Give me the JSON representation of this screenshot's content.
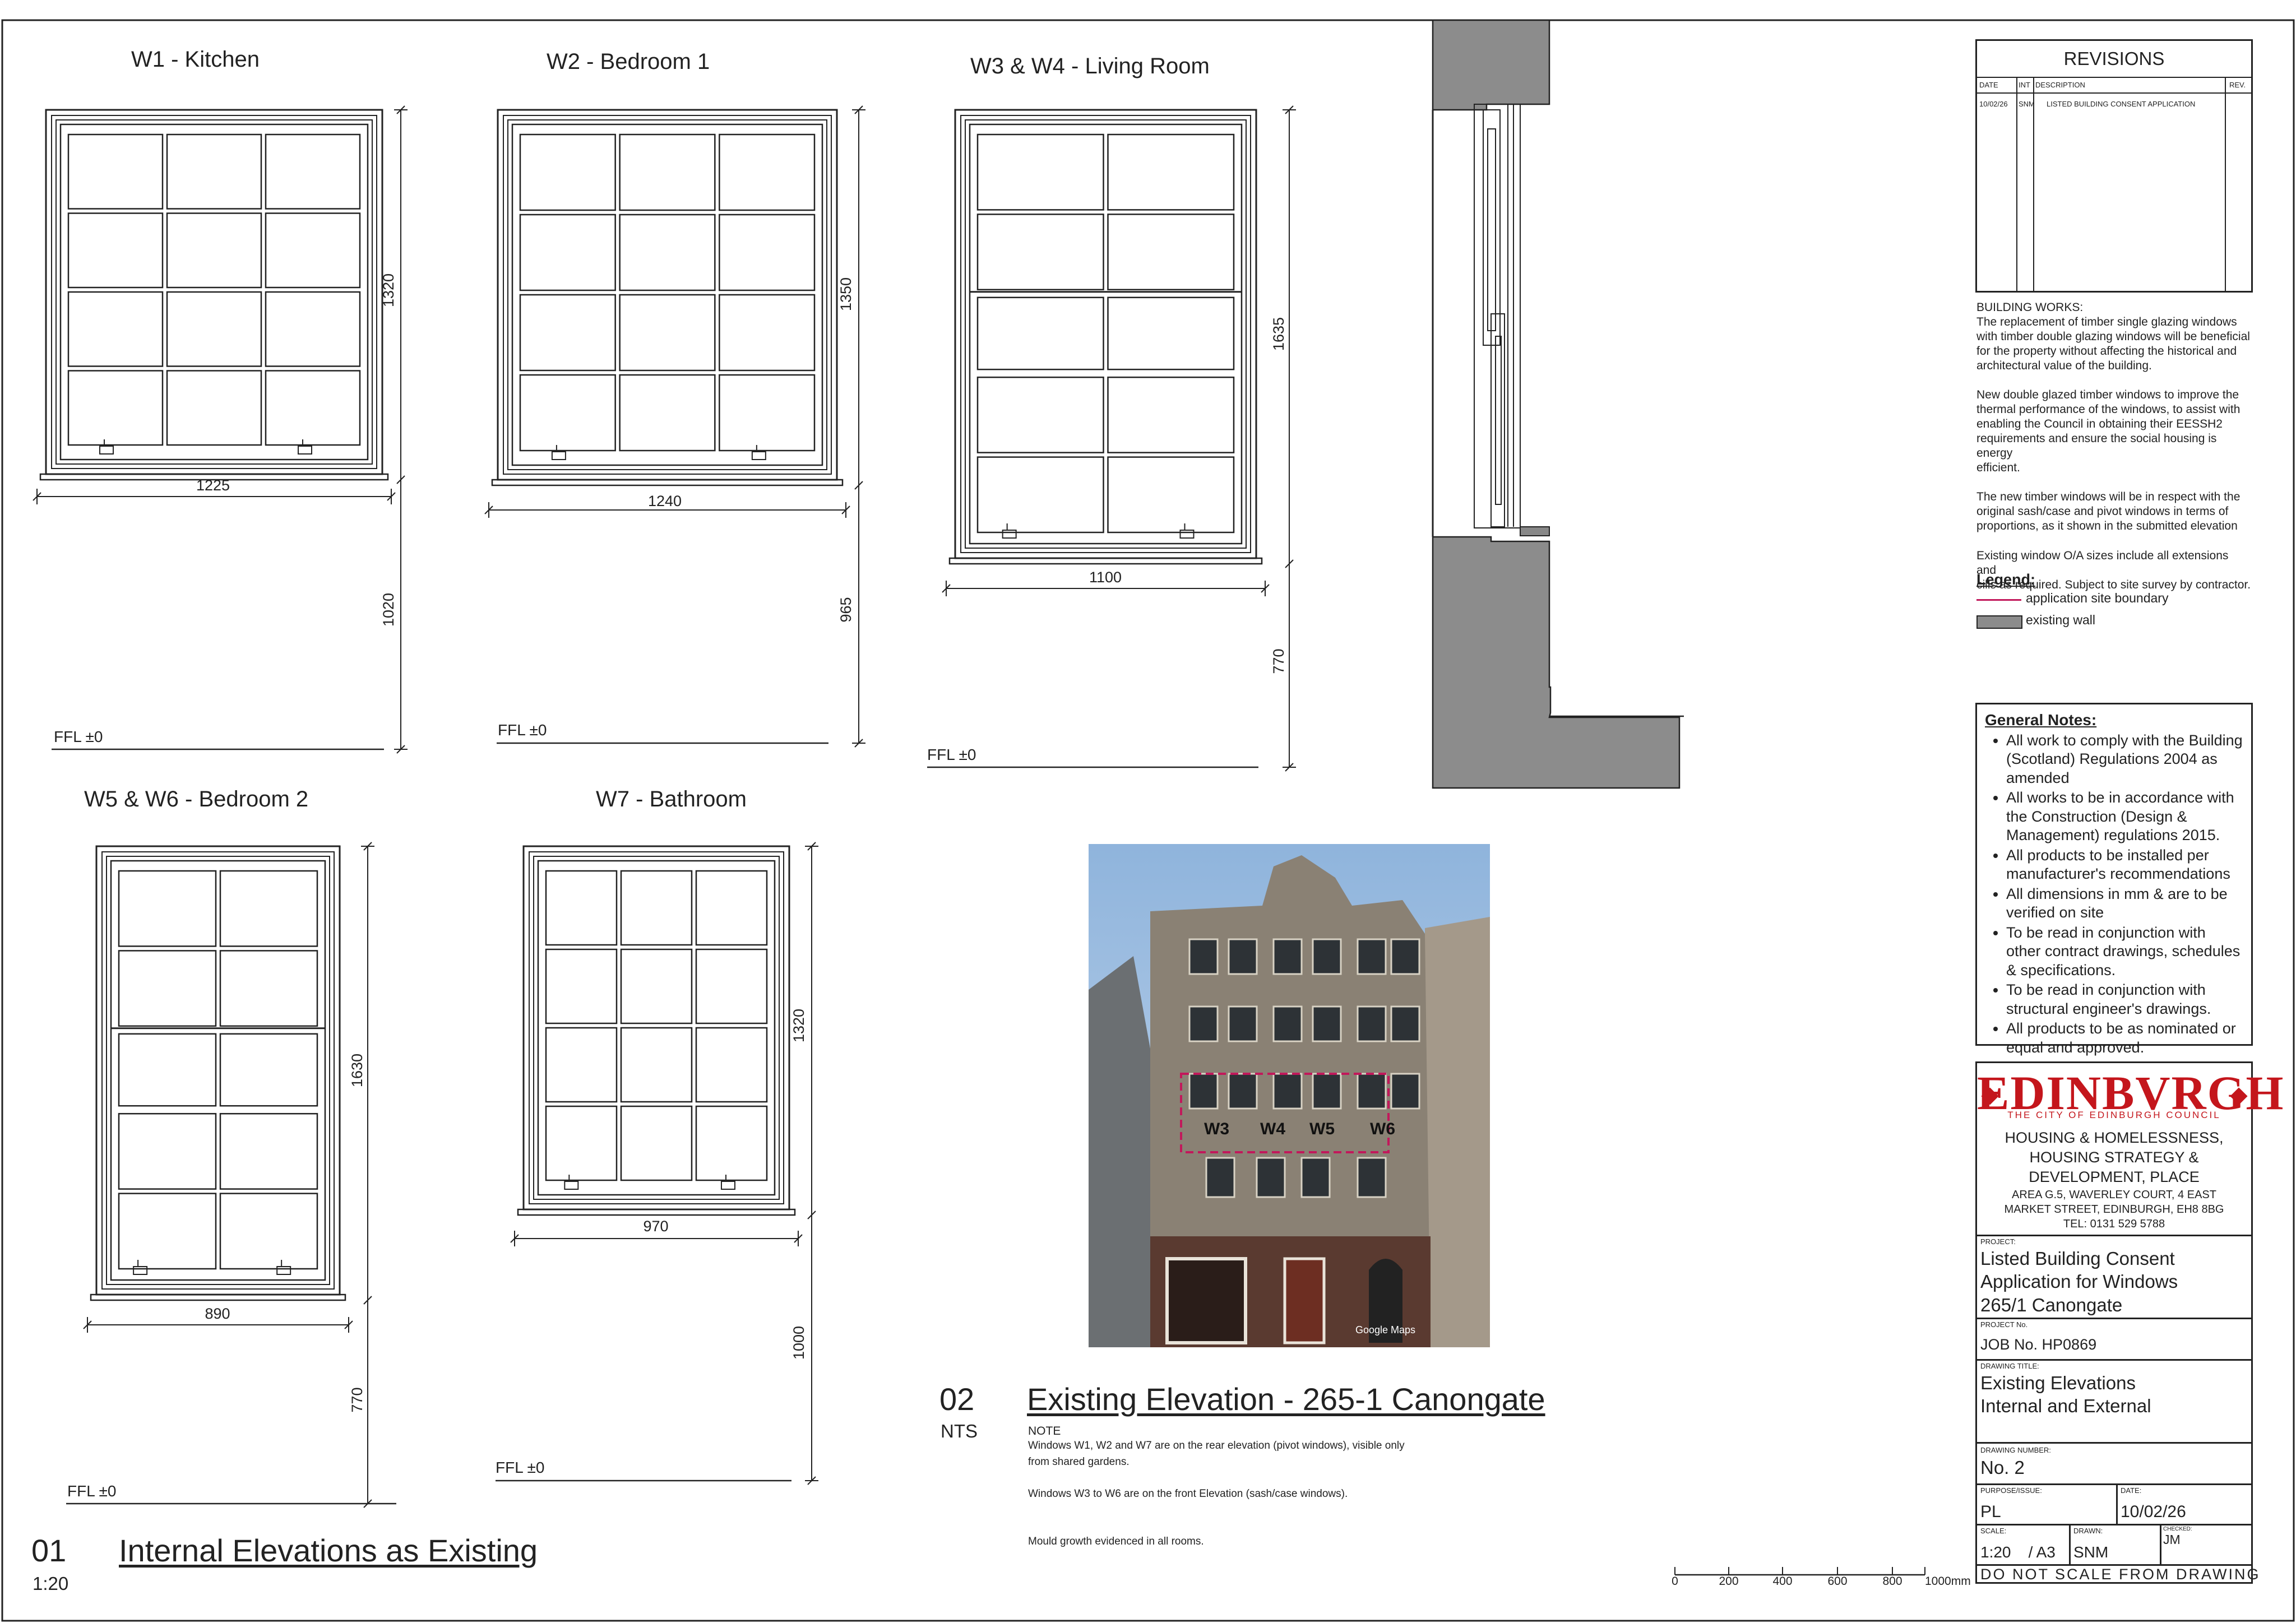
{
  "internal_elevations": {
    "windows": [
      {
        "id": "w1",
        "title": "W1 - Kitchen",
        "width": "1225",
        "height": "1320",
        "sill": "1020",
        "ffl": "FFL ±0"
      },
      {
        "id": "w2",
        "title": "W2 - Bedroom 1",
        "width": "1240",
        "height": "1350",
        "sill": "965",
        "ffl": "FFL ±0"
      },
      {
        "id": "w3",
        "title": "W3 & W4 - Living Room",
        "width": "1100",
        "height": "1635",
        "sill": "770",
        "ffl": "FFL ±0"
      },
      {
        "id": "w5",
        "title": "W5 & W6 - Bedroom 2",
        "width": "890",
        "height": "1630",
        "sill": "770",
        "ffl": "FFL ±0"
      },
      {
        "id": "w7",
        "title": "W7 - Bathroom",
        "width": "970",
        "height": "1320",
        "sill": "1000",
        "ffl": "FFL ±0"
      }
    ],
    "section_number": "01",
    "section_title": "Internal Elevations as Existing",
    "scale": "1:20"
  },
  "existing_elevation": {
    "section_number": "02",
    "section_title": "Existing Elevation - 265-1 Canongate",
    "scale": "NTS",
    "note_heading": "NOTE",
    "notes": "Windows W1, W2 and W7 are on the rear elevation (pivot windows), visible only\nfrom shared gardens.\n\nWindows W3 to W6 are on the front Elevation (sash/case windows).\n\n\nMould growth evidenced in all rooms.",
    "photo_labels": [
      "W3",
      "W4",
      "W5",
      "W6"
    ],
    "photo_credit": "Google Maps"
  },
  "scale_bar": {
    "ticks": [
      "0",
      "200",
      "400",
      "600",
      "800",
      "1000mm"
    ]
  },
  "revisions": {
    "title": "REVISIONS",
    "headers": [
      "DATE",
      "INT",
      "DESCRIPTION",
      "REV."
    ],
    "rows": [
      {
        "date": "10/02/26",
        "int": "SNM",
        "description": "LISTED BUILDING CONSENT APPLICATION",
        "rev": ""
      }
    ]
  },
  "building_works": "BUILDING WORKS:\nThe replacement of timber single glazing windows\nwith timber double glazing windows will be beneficial\nfor the property without affecting the historical and\narchitectural value of the building.\n\nNew double glazed timber windows to improve the\nthermal performance of the windows, to assist with\nenabling the Council in obtaining their EESSH2\nrequirements and ensure the social housing is energy\nefficient.\n\nThe new timber windows will be in respect with the\noriginal sash/case and pivot windows in terms of\nproportions, as it shown in the submitted elevation\n\nExisting window O/A sizes include all extensions and\ncills as required. Subject to site survey by contractor.",
  "legend": {
    "title": "Legend:",
    "items": [
      {
        "label": "application site boundary",
        "color": "#c2185b"
      },
      {
        "label": "existing wall",
        "color": "#8c8c8c"
      }
    ]
  },
  "general_notes": {
    "title": "General Notes:",
    "items": [
      "All work to comply with the Building (Scotland) Regulations 2004 as amended",
      "All works to be in accordance with the Construction (Design & Management) regulations 2015.",
      "All products to be installed per manufacturer's recommendations",
      "All dimensions in mm & are to be verified on site",
      "To be read in conjunction with other contract drawings, schedules & specifications.",
      "To be read in conjunction with structural engineer's drawings.",
      "All products to be as nominated or equal and approved."
    ]
  },
  "title_block": {
    "logo_text": "EDINBVRGH",
    "logo_subtitle": "THE CITY OF EDINBURGH COUNCIL",
    "department": "HOUSING & HOMELESSNESS,\nHOUSING STRATEGY &\nDEVELOPMENT, PLACE",
    "address": "AREA G.5, WAVERLEY COURT, 4 EAST\nMARKET STREET, EDINBURGH, EH8 8BG\nTEL: 0131 529 5788",
    "project_label": "PROJECT:",
    "project": "Listed Building Consent\nApplication for Windows\n265/1 Canongate",
    "project_no_label": "PROJECT No.",
    "project_no": "JOB No. HP0869",
    "drawing_title_label": "DRAWING TITLE:",
    "drawing_title": "Existing Elevations\nInternal and External",
    "drawing_number_label": "DRAWING NUMBER:",
    "drawing_number": "No. 2",
    "purpose_label": "PURPOSE/ISSUE:",
    "purpose": "PL",
    "date_label": "DATE:",
    "date": "10/02/26",
    "scale_label": "SCALE:",
    "scale": "1:20    / A3",
    "drawn_label": "DRAWN:",
    "drawn": "SNM",
    "checked_label": "CHECKED:",
    "checked": "JM",
    "footer": "DO NOT SCALE FROM DRAWING"
  },
  "colors": {
    "line": "#222222",
    "wall": "#8c8c8c",
    "boundary": "#c2185b",
    "logo": "#c4161c"
  }
}
